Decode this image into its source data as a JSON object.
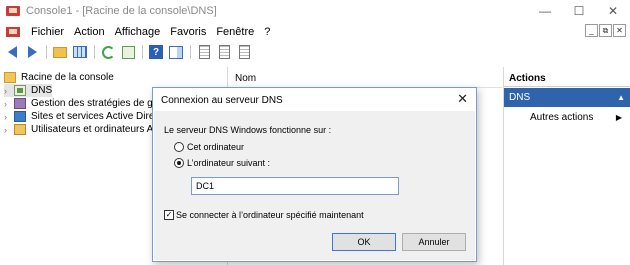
{
  "window": {
    "title": "Console1 - [Racine de la console\\DNS]",
    "minimize": "—",
    "maximize": "☐",
    "close": "✕"
  },
  "menu": {
    "items": [
      "Fichier",
      "Action",
      "Affichage",
      "Favoris",
      "Fenêtre",
      "?"
    ],
    "mdi": [
      "_",
      "⧉",
      "✕"
    ]
  },
  "tree": {
    "items": [
      {
        "label": "Racine de la console",
        "icon": "folder-icon"
      },
      {
        "label": "DNS",
        "icon": "dns-icon"
      },
      {
        "label": "Gestion des stratégies de g",
        "icon": "gpo-icon"
      },
      {
        "label": "Sites et services Active Dire",
        "icon": "sites-icon"
      },
      {
        "label": "Utilisateurs et ordinateurs A",
        "icon": "users-icon"
      }
    ]
  },
  "center": {
    "column_header": "Nom"
  },
  "actions": {
    "header": "Actions",
    "group": "DNS",
    "other": "Autres actions"
  },
  "dialog": {
    "title": "Connexion au serveur DNS",
    "prompt": "Le serveur DNS Windows fonctionne sur :",
    "option_this": "Cet ordinateur",
    "option_other": "L’ordinateur suivant :",
    "selected_option": "option_other",
    "computer_value": "DC1",
    "connect_now": "Se connecter à l’ordinateur spécifié maintenant",
    "connect_now_checked": true,
    "ok": "OK",
    "cancel": "Annuler"
  }
}
